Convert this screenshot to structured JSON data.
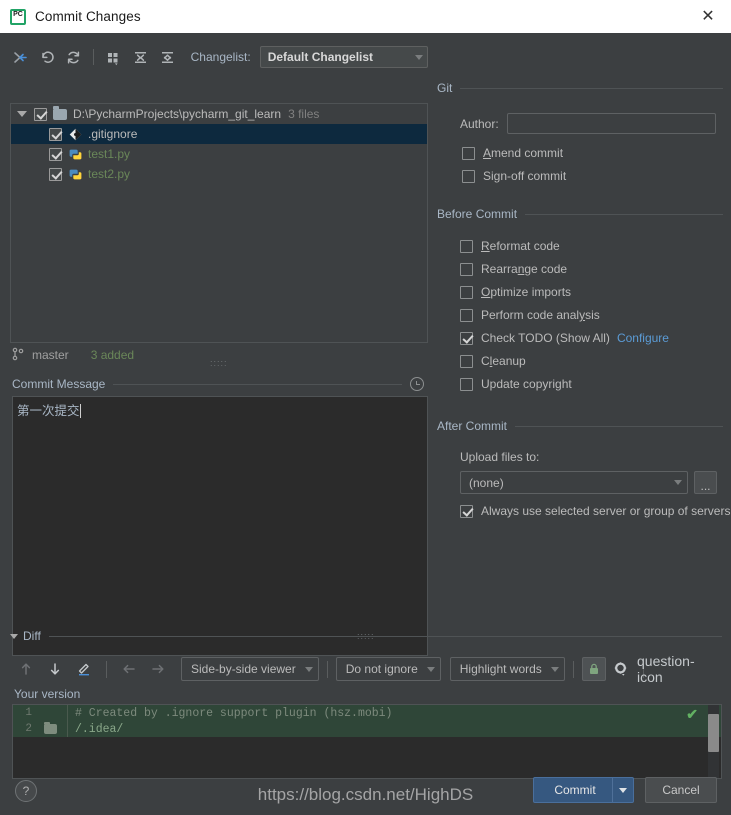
{
  "window": {
    "title": "Commit Changes",
    "app_icon": "pycharm-icon",
    "close_label": "✕"
  },
  "toolbar": {
    "buttons": [
      {
        "name": "show-diff-icon",
        "tooltip": "Show Diff"
      },
      {
        "name": "rollback-icon",
        "tooltip": "Revert"
      },
      {
        "name": "refresh-icon",
        "tooltip": "Refresh"
      },
      {
        "name": "group-by-icon",
        "tooltip": "Group By"
      },
      {
        "name": "expand-all-icon",
        "tooltip": "Expand All"
      },
      {
        "name": "collapse-all-icon",
        "tooltip": "Collapse All"
      }
    ],
    "changelist_label": "Changelist:",
    "changelist_value": "Default Changelist"
  },
  "tree": {
    "root": {
      "path": "D:\\PycharmProjects\\pycharm_git_learn",
      "count": "3 files",
      "checked": true,
      "expanded": true
    },
    "files": [
      {
        "name": ".gitignore",
        "icon": "git-file-icon",
        "checked": true,
        "selected": true,
        "color": "plain"
      },
      {
        "name": "test1.py",
        "icon": "python-file-icon",
        "checked": true,
        "selected": false,
        "color": "added"
      },
      {
        "name": "test2.py",
        "icon": "python-file-icon",
        "checked": true,
        "selected": false,
        "color": "added"
      }
    ]
  },
  "status": {
    "branch_icon": "git-branch-icon",
    "branch": "master",
    "changes": "3 added"
  },
  "commit_message": {
    "title": "Commit Message",
    "history_icon": "clock-history-icon",
    "value": "第一次提交"
  },
  "git_section": {
    "title": "Git",
    "author_label": "Author:",
    "author_value": "",
    "author_placeholder": "",
    "checkboxes": [
      {
        "label": "Amend commit",
        "mnemonic": "A",
        "checked": false
      },
      {
        "label": "Sign-off commit",
        "mnemonic": "g",
        "checked": false
      }
    ]
  },
  "before_commit": {
    "title": "Before Commit",
    "checkboxes": [
      {
        "label": "Reformat code",
        "mnemonic": "R",
        "checked": false,
        "link": ""
      },
      {
        "label": "Rearrange code",
        "mnemonic": "n",
        "checked": false,
        "link": ""
      },
      {
        "label": "Optimize imports",
        "mnemonic": "O",
        "checked": false,
        "link": ""
      },
      {
        "label": "Perform code analysis",
        "mnemonic": "y",
        "checked": false,
        "link": ""
      },
      {
        "label": "Check TODO (Show All)",
        "mnemonic": "",
        "checked": true,
        "link": "Configure"
      },
      {
        "label": "Cleanup",
        "mnemonic": "l",
        "checked": false,
        "link": ""
      },
      {
        "label": "Update copyright",
        "mnemonic": "",
        "checked": false,
        "link": ""
      }
    ]
  },
  "after_commit": {
    "title": "After Commit",
    "upload_label": "Upload files to:",
    "upload_value": "(none)",
    "browse_label": "...",
    "always_use_label": "Always use selected server or group of servers",
    "always_use_checked": true
  },
  "diff": {
    "title": "Diff",
    "expanded": true,
    "buttons": [
      {
        "name": "previous-difference-icon",
        "tooltip": "Previous Difference",
        "enabled": false
      },
      {
        "name": "next-difference-icon",
        "tooltip": "Next Difference",
        "enabled": true
      },
      {
        "name": "apply-change-icon",
        "tooltip": "Edit",
        "enabled": true
      },
      {
        "name": "arrow-left-icon",
        "tooltip": "Accept Left",
        "enabled": false
      },
      {
        "name": "arrow-right-icon",
        "tooltip": "Accept Right",
        "enabled": false
      }
    ],
    "viewer_mode": "Side-by-side viewer",
    "whitespace_mode": "Do not ignore",
    "highlight_mode": "Highlight words",
    "lock_icon": "lock-icon",
    "settings_icon": "gear-icon",
    "help_icon": "question-icon",
    "your_version_label": "Your version",
    "lines": [
      {
        "number": "1",
        "gutter_icon": "",
        "text": "# Created by .ignore support plugin (hsz.mobi)",
        "added": true
      },
      {
        "number": "2",
        "gutter_icon": "folder-icon",
        "text": "/.idea/",
        "added": true
      }
    ],
    "status_icon": "green-check-icon"
  },
  "footer": {
    "help_label": "?",
    "commit_label": "Commit",
    "commit_dropdown_icon": "chevron-down-icon",
    "cancel_label": "Cancel"
  },
  "watermark": {
    "text": "https://blog.csdn.net/HighDS"
  },
  "colors": {
    "accent_blue": "#365880",
    "link_blue": "#5b9bd5",
    "added_green": "#6a8759",
    "panel_bg": "#3c3f41",
    "field_bg": "#2b2b2b",
    "selection": "#0d293e"
  }
}
